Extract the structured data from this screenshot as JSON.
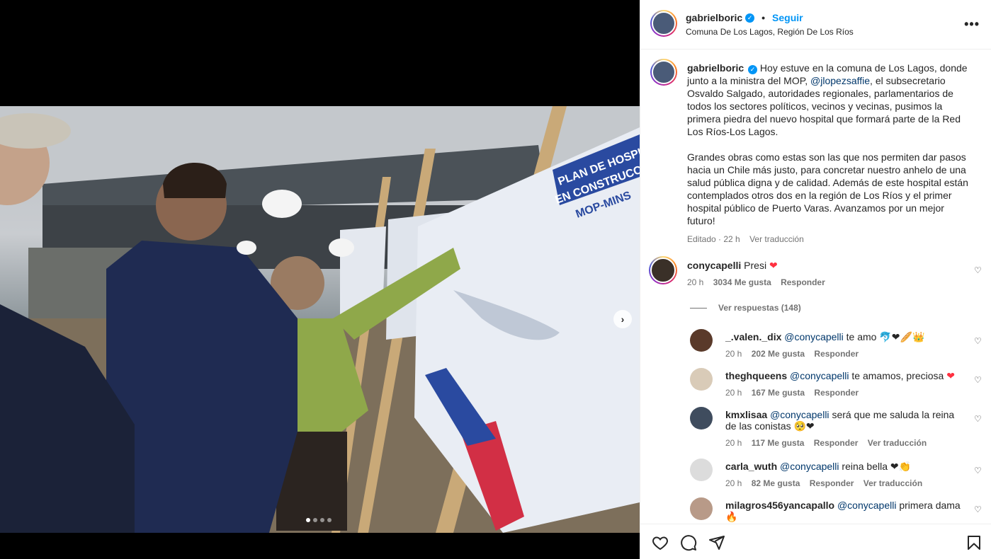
{
  "post": {
    "username": "gabrielboric",
    "follow_label": "Seguir",
    "location": "Comuna De Los Lagos, Región De Los Ríos",
    "more_label": "•••"
  },
  "caption": {
    "username": "gabrielboric",
    "text_1": " Hoy estuve en la comuna de Los Lagos, donde junto a la ministra del MOP, ",
    "mention": "@jlopezsaffie",
    "text_2": ", el subsecretario Osvaldo Salgado, autoridades regionales, parlamentarios de todos los sectores políticos, vecinos y vecinas, pusimos la primera piedra del nuevo hospital que formará parte de la Red Los Ríos-Los Lagos.",
    "paragraph_2": "Grandes obras como estas son las que nos permiten dar pasos hacia un Chile más justo, para concretar nuestro anhelo de una salud pública digna y de calidad. Además de este hospital están contemplados otros dos en la región de Los Ríos y el primer hospital público de Puerto Varas. Avanzamos por un mejor futuro!",
    "edited": "Editado · 22 h",
    "translate": "Ver traducción"
  },
  "top_comment": {
    "username": "conycapelli",
    "text": "Presi",
    "emoji": "❤",
    "time": "20 h",
    "likes": "3034 Me gusta",
    "reply": "Responder",
    "view_replies": "Ver respuestas (148)"
  },
  "replies": [
    {
      "username": "_.valen._dix",
      "mention": "@conycapelli",
      "text": "te amo",
      "emoji": "🐬❤🥖👑",
      "time": "20 h",
      "likes": "202 Me gusta",
      "reply": "Responder",
      "translate": ""
    },
    {
      "username": "theghqueens",
      "mention": "@conycapelli",
      "text": "te amamos, preciosa",
      "emoji": "❤",
      "time": "20 h",
      "likes": "167 Me gusta",
      "reply": "Responder",
      "translate": ""
    },
    {
      "username": "kmxlisaa",
      "mention": "@conycapelli",
      "text": "será que me saluda la reina de las conistas",
      "emoji": "🥺❤",
      "time": "20 h",
      "likes": "117 Me gusta",
      "reply": "Responder",
      "translate": "Ver traducción"
    },
    {
      "username": "carla_wuth",
      "mention": "@conycapelli",
      "text": "reina bella",
      "emoji": "❤👏",
      "time": "20 h",
      "likes": "82 Me gusta",
      "reply": "Responder",
      "translate": "Ver traducción"
    },
    {
      "username": "milagros456yancapallo",
      "mention": "@conycapelli",
      "text": "primera dama",
      "emoji": "🔥",
      "time": "",
      "likes": "",
      "reply": "",
      "translate": ""
    }
  ],
  "photo": {
    "sign_line_1": "PLAN DE HOSPI",
    "sign_line_2": "EN CONSTRUCC",
    "sign_line_3": "MOP-MINS"
  },
  "colors": {
    "accent": "#0095f6",
    "heart": "#ff3040",
    "mention": "#00376b",
    "muted": "#737373"
  },
  "icons": [
    "verified-icon",
    "heart-icon",
    "comment-icon",
    "share-icon",
    "bookmark-icon",
    "more-icon",
    "chevron-right-icon"
  ]
}
